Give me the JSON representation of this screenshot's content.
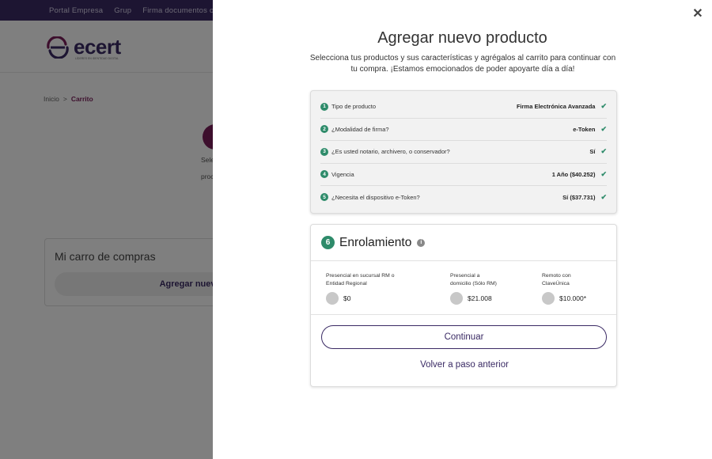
{
  "topnav": {
    "items": [
      "Portal Empresa",
      "Grup",
      "Firma documentos o"
    ]
  },
  "logo": {
    "word": "ecert",
    "tagline": "LÍDERES EN IDENTIDAD DIGITAL"
  },
  "breadcrumb": {
    "home": "Inicio",
    "separator": ">",
    "current": "Carrito"
  },
  "background": {
    "text1": "Sele",
    "text2": "proc"
  },
  "cart": {
    "title": "Mi carro de compras",
    "add_button": "Agregar nuevo p"
  },
  "panel": {
    "title": "Agregar nuevo producto",
    "subtitle": "Selecciona tus productos y sus características y agrégalos al carrito para continuar con tu compra. ¡Estamos emocionados de poder apoyarte día a día!"
  },
  "summary": [
    {
      "num": "1",
      "question": "Tipo de producto",
      "answer": "Firma Electrónica Avanzada"
    },
    {
      "num": "2",
      "question": "¿Modalidad de firma?",
      "answer": "e-Token"
    },
    {
      "num": "3",
      "question": "¿Es usted notario, archivero, o conservador?",
      "answer": "Sí"
    },
    {
      "num": "4",
      "question": "Vigencia",
      "answer": "1 Año ($40.252)"
    },
    {
      "num": "5",
      "question": "¿Necesita el dispositivo e-Token?",
      "answer": "Sí ($37.731)"
    }
  ],
  "enrolamiento": {
    "num": "6",
    "title": "Enrolamiento",
    "options": [
      {
        "label_1": "Presencial en sucursal RM o",
        "label_2": "Entidad Regional",
        "price": "$0"
      },
      {
        "label_1": "Presencial a",
        "label_2": "domicilio (Sólo RM)",
        "price": "$21.008"
      },
      {
        "label_1": "Remoto con",
        "label_2": "ClaveÚnica",
        "price": "$10.000*"
      }
    ],
    "continue_label": "Continuar",
    "back_label": "Volver a paso anterior"
  },
  "colors": {
    "brand": "#3a2a64",
    "accent": "#7a1f5a",
    "success": "#2e8b6a"
  },
  "icons": {
    "close": "close-icon",
    "check": "check-icon",
    "info": "info-icon"
  }
}
